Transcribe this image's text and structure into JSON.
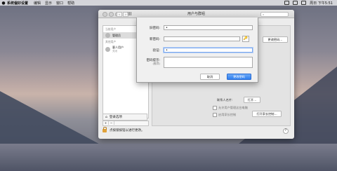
{
  "menubar": {
    "app_name": "系统偏好设置",
    "items": [
      "编辑",
      "显示",
      "窗口",
      "帮助"
    ],
    "clock": "周日 下午5:51"
  },
  "window": {
    "title": "用户与群组",
    "sidebar": {
      "current_user_header": "当前用户",
      "current_user_name": "管理员",
      "other_users_header": "其他用户",
      "guest_name": "客人用户",
      "guest_status": "关闭",
      "login_options": "登录选项"
    },
    "main": {
      "change_password_button": "更改密码…",
      "contact_card_label": "联系人名片:",
      "open_button": "打开…",
      "allow_admin_label": "允许用户管理这台电脑",
      "parental_controls_label": "启用家长控制",
      "open_parental_button": "打开家长控制…"
    },
    "footer": {
      "lock_text": "点按锁按钮以进行更改。",
      "help": "?"
    }
  },
  "sheet": {
    "old_password_label": "旧密码:",
    "old_password_value": "•",
    "new_password_label": "新密码:",
    "new_password_value": "",
    "verify_label": "验证:",
    "verify_value": "•",
    "hint_label": "密码提示:",
    "hint_sub": "(推荐)",
    "hint_value": "",
    "key_icon": "🔑",
    "cancel_button": "取消",
    "change_button": "更改密码"
  }
}
